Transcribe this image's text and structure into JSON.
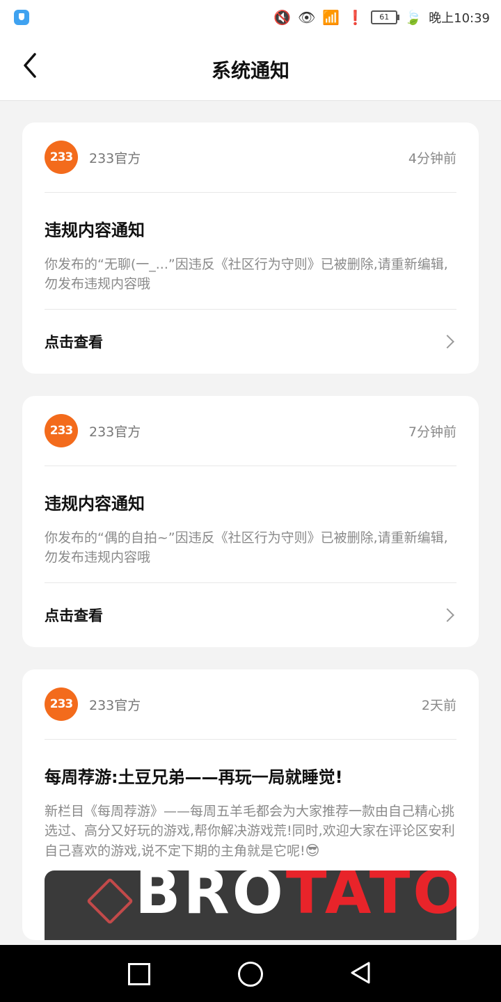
{
  "status_bar": {
    "time": "晚上10:39",
    "battery": "61",
    "icons": [
      "shield-app-icon",
      "mute-icon",
      "eye-icon",
      "wifi-icon",
      "alert-icon",
      "battery-icon",
      "leaf-icon"
    ]
  },
  "header": {
    "title": "系统通知"
  },
  "notifications": [
    {
      "sender": "233官方",
      "logo_text": "233",
      "time": "4分钟前",
      "title": "违规内容通知",
      "body": "你发布的“无聊(一_...”因违反《社区行为守则》已被删除,请重新编辑,勿发布违规内容哦",
      "link": "点击查看"
    },
    {
      "sender": "233官方",
      "logo_text": "233",
      "time": "7分钟前",
      "title": "违规内容通知",
      "body": "你发布的“偶的自拍~”因违反《社区行为守则》已被删除,请重新编辑,勿发布违规内容哦",
      "link": "点击查看"
    },
    {
      "sender": "233官方",
      "logo_text": "233",
      "time": "2天前",
      "title": "每周荐游:土豆兄弟——再玩一局就睡觉!",
      "body": "新栏目《每周荐游》——每周五羊毛都会为大家推荐一款由自己精心挑选过、高分又好玩的游戏,帮你解决游戏荒!同时,欢迎大家在评论区安利自己喜欢的游戏,说不定下期的主角就是它呢!",
      "emoji": "😎",
      "banner_text_white": "BRO",
      "banner_text_red": "TATO"
    }
  ],
  "colors": {
    "accent_orange": "#f36b1c",
    "background": "#f3f3f3"
  }
}
